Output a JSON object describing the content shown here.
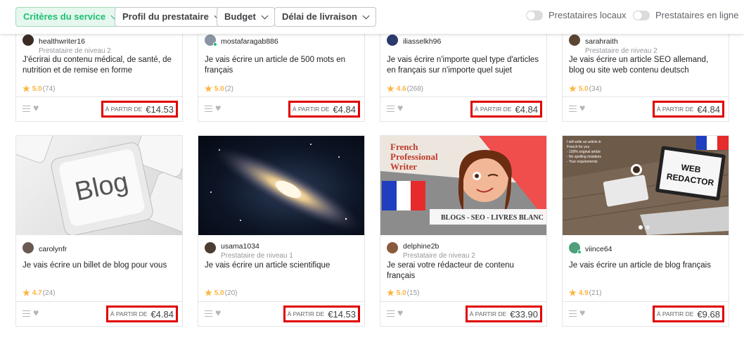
{
  "filters": {
    "service_criteria": "Critères du service",
    "seller_profile": "Profil du prestataire",
    "budget": "Budget",
    "delivery_time": "Délai de livraison",
    "local_sellers": "Prestataires locaux",
    "online_sellers": "Prestataires en ligne"
  },
  "price_prefix": "À PARTIR DE",
  "gigs": [
    {
      "seller": "healthwriter16",
      "level": "Prestataire de niveau 2",
      "title": "J'écrirai du contenu médical, de santé, de nutrition et de remise en forme",
      "rating": "5.0",
      "reviews": "(74)",
      "price": "€14.53"
    },
    {
      "seller": "mostafaragab886",
      "level": "",
      "title": "Je vais écrire un article de 500 mots en français",
      "rating": "5.0",
      "reviews": "(2)",
      "price": "€4.84"
    },
    {
      "seller": "iliasselkh96",
      "level": "",
      "title": "Je vais écrire n'importe quel type d'articles en français sur n'importe quel sujet",
      "rating": "4.6",
      "reviews": "(268)",
      "price": "€4.84"
    },
    {
      "seller": "sarahraith",
      "level": "Prestataire de niveau 2",
      "title": "Je vais écrire un article SEO allemand, blog ou site web contenu deutsch",
      "rating": "5.0",
      "reviews": "(34)",
      "price": "€4.84"
    },
    {
      "seller": "carolynfr",
      "level": "",
      "title": "Je vais écrire un billet de blog pour vous",
      "rating": "4.7",
      "reviews": "(24)",
      "price": "€4.84"
    },
    {
      "seller": "usama1034",
      "level": "Prestataire de niveau 1",
      "title": "Je vais écrire un article scientifique",
      "rating": "5.0",
      "reviews": "(20)",
      "price": "€14.53"
    },
    {
      "seller": "delphine2b",
      "level": "Prestataire de niveau 2",
      "title": "Je serai votre rédacteur de contenu français",
      "rating": "5.0",
      "reviews": "(15)",
      "price": "€33.90"
    },
    {
      "seller": "viince64",
      "level": "",
      "title": "Je vais écrire un article de blog français",
      "rating": "4.9",
      "reviews": "(21)",
      "price": "€9.68"
    }
  ],
  "thumbs": {
    "blog_key": "Blog",
    "writer_line1": "French",
    "writer_line2": "Professional",
    "writer_line3": "Writer",
    "writer_banner": "BLOGS - SEO - LIVRES BLANC",
    "web_line1": "WEB",
    "web_line2": "REDACTOR"
  }
}
